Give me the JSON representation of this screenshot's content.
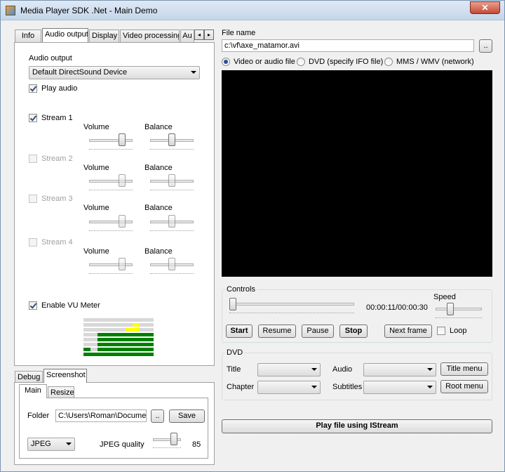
{
  "window": {
    "title": "Media Player SDK .Net - Main Demo",
    "close_glyph": "✕"
  },
  "left_tabs": [
    {
      "label": "Info"
    },
    {
      "label": "Audio output"
    },
    {
      "label": "Display"
    },
    {
      "label": "Video processing"
    },
    {
      "label": "Au"
    }
  ],
  "audio_output": {
    "section_label": "Audio output",
    "device": "Default DirectSound Device",
    "play_audio_label": "Play audio",
    "play_audio": true,
    "streams": [
      {
        "label": "Stream 1",
        "enabled": true,
        "checked": true,
        "volume_label": "Volume",
        "balance_label": "Balance"
      },
      {
        "label": "Stream 2",
        "enabled": false,
        "checked": false,
        "volume_label": "Volume",
        "balance_label": "Balance"
      },
      {
        "label": "Stream 3",
        "enabled": false,
        "checked": false,
        "volume_label": "Volume",
        "balance_label": "Balance"
      },
      {
        "label": "Stream 4",
        "enabled": false,
        "checked": false,
        "volume_label": "Volume",
        "balance_label": "Balance"
      }
    ],
    "vu_meter_label": "Enable VU Meter",
    "vu_meter": true,
    "vu_levels": [
      2,
      1,
      5,
      5,
      5,
      5,
      6,
      7,
      5,
      5
    ],
    "vu_colors": {
      "green": "#008000",
      "yellow": "#ffff00",
      "off": "#d8d8d8"
    }
  },
  "bottom_tabs": [
    {
      "label": "Debug"
    },
    {
      "label": "Screenshot"
    }
  ],
  "screenshot_tabs": [
    {
      "label": "Main"
    },
    {
      "label": "Resize"
    }
  ],
  "screenshot": {
    "folder_label": "Folder",
    "folder_value": "C:\\Users\\Roman\\Documents",
    "browse_label": "..",
    "save_label": "Save",
    "format": "JPEG",
    "quality_label": "JPEG quality",
    "quality_value": "85"
  },
  "file": {
    "label": "File name",
    "value": "c:\\vf\\axe_matamor.avi",
    "browse_label": "..",
    "source_options": [
      {
        "label": "Video or audio file",
        "selected": true
      },
      {
        "label": "DVD (specify IFO file)",
        "selected": false
      },
      {
        "label": "MMS / WMV (network)",
        "selected": false
      }
    ]
  },
  "controls": {
    "group_label": "Controls",
    "time": "00:00:11/00:00:30",
    "speed_label": "Speed",
    "start_label": "Start",
    "resume_label": "Resume",
    "pause_label": "Pause",
    "stop_label": "Stop",
    "next_frame_label": "Next frame",
    "loop_label": "Loop",
    "loop": false
  },
  "dvd": {
    "group_label": "DVD",
    "title_label": "Title",
    "audio_label": "Audio",
    "title_menu_label": "Title menu",
    "chapter_label": "Chapter",
    "subtitles_label": "Subtitles",
    "root_menu_label": "Root menu"
  },
  "play_istream_label": "Play file using IStream"
}
